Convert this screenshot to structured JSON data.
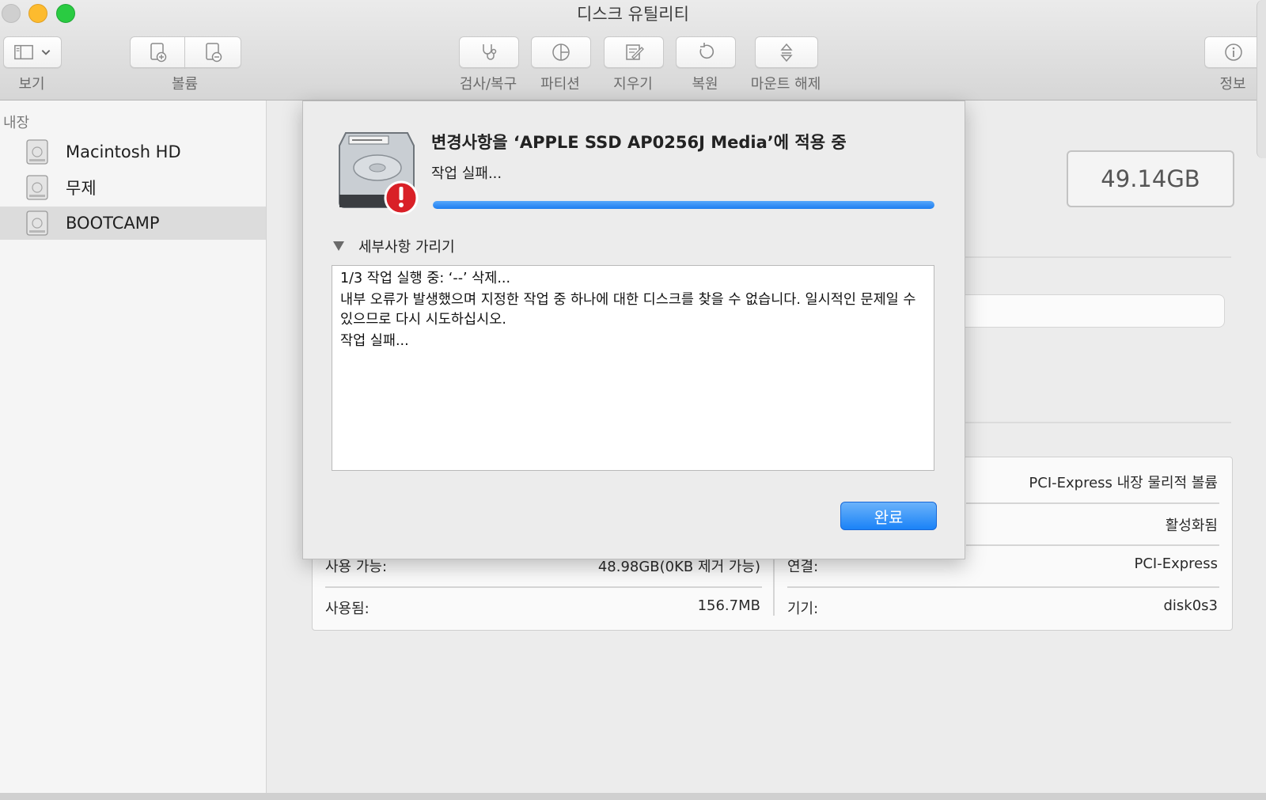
{
  "window": {
    "title": "디스크 유틸리티"
  },
  "toolbar": {
    "view_label": "보기",
    "volume_label": "볼륨",
    "first_aid_label": "검사/복구",
    "partition_label": "파티션",
    "erase_label": "지우기",
    "restore_label": "복원",
    "unmount_label": "마운트 해제",
    "info_label": "정보",
    "icons": [
      "sidebar-icon",
      "chevron-down-icon",
      "add-volume-icon",
      "remove-volume-icon",
      "stethoscope-icon",
      "pie-chart-icon",
      "erase-icon",
      "restore-icon",
      "eject-icon",
      "info-icon"
    ]
  },
  "sidebar": {
    "section_label": "내장",
    "items": [
      {
        "label": "Macintosh HD",
        "icon": "disk-icon",
        "selected": false
      },
      {
        "label": "무제",
        "icon": "disk-icon",
        "selected": false
      },
      {
        "label": "BOOTCAMP",
        "icon": "disk-icon",
        "selected": true
      }
    ]
  },
  "main": {
    "capacity": "49.14GB",
    "info": {
      "available_label": "사용 가능:",
      "available_value": "48.98GB(0KB 제거 가능)",
      "used_label": "사용됨:",
      "used_value": "156.7MB",
      "type_value": "PCI-Express 내장 물리적 볼륨",
      "status_value": "활성화됨",
      "connection_label": "연결:",
      "connection_value": "PCI-Express",
      "device_label": "기기:",
      "device_value": "disk0s3"
    }
  },
  "dialog": {
    "title": "변경사항을 ‘APPLE SSD AP0256J Media’에 적용 중",
    "subtitle": "작업 실패...",
    "progress_fraction": 1.0,
    "progress_color": "#2d8cf4",
    "details_toggle": "세부사항 가리기",
    "log_line1": "1/3 작업 실행 중: ‘--’ 삭제...",
    "log_line2": "내부 오류가 발생했으며 지정한 작업 중 하나에 대한 디스크를 찾을 수 없습니다. 일시적인 문제일 수 있으므로 다시 시도하십시오.",
    "log_line3": "작업 실패...",
    "done_button": "완료",
    "icon": "disk-error-icon"
  }
}
